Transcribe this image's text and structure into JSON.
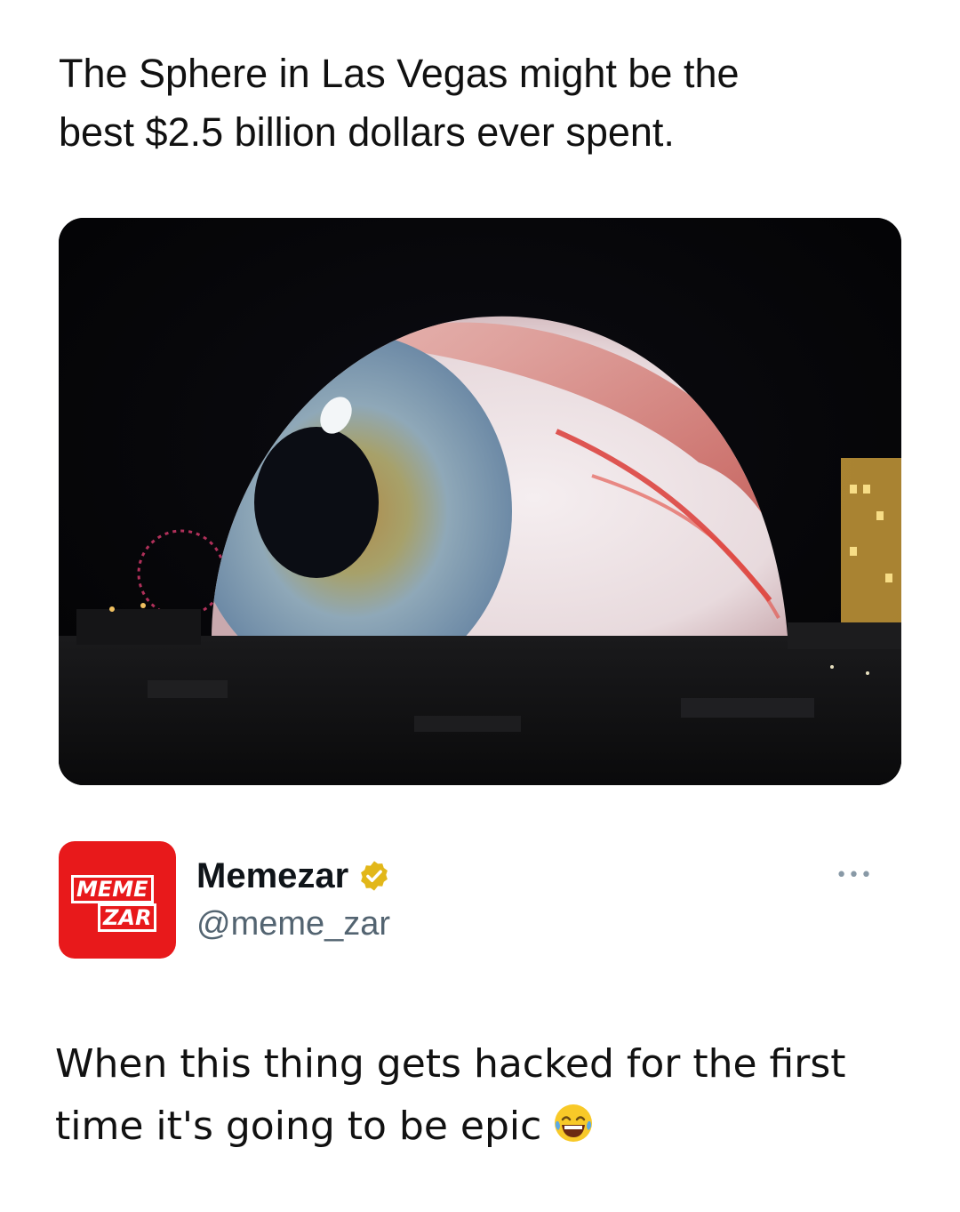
{
  "caption": {
    "line1": "The Sphere in Las Vegas might be the",
    "line2": "best $2.5 billion dollars ever spent."
  },
  "media": {
    "icon": "photo-sphere-eye",
    "colors": {
      "night": "#050507",
      "sclera": "#efe6e8",
      "iris": "#7f9db4",
      "vein": "#d9312c"
    }
  },
  "author": {
    "avatar": {
      "line1": "MEME",
      "line2": "ZAR",
      "color": "#e8191b"
    },
    "display_name": "Memezar",
    "handle": "@meme_zar",
    "verified_color": "#e2b719",
    "more_icon": "more-icon"
  },
  "tweet": {
    "line1": "When this thing gets hacked for the first",
    "line2": "time it's going to be epic",
    "emoji": "laughing-tears-emoji"
  }
}
